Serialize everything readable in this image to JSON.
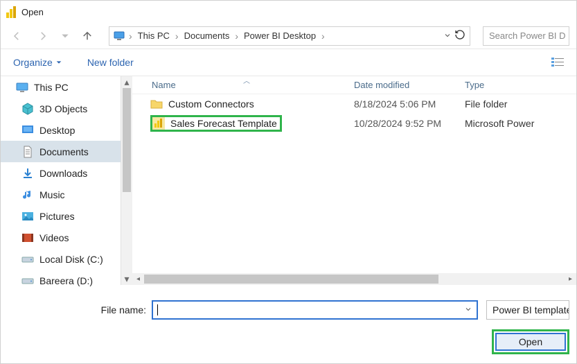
{
  "window": {
    "title": "Open"
  },
  "breadcrumb": {
    "root": "This PC",
    "a": "Documents",
    "b": "Power BI Desktop"
  },
  "search": {
    "placeholder": "Search Power BI D"
  },
  "toolbar": {
    "organize": "Organize",
    "newfolder": "New folder"
  },
  "columns": {
    "name": "Name",
    "date": "Date modified",
    "type": "Type"
  },
  "tree": {
    "root": "This PC",
    "items": [
      "3D Objects",
      "Desktop",
      "Documents",
      "Downloads",
      "Music",
      "Pictures",
      "Videos",
      "Local Disk (C:)",
      "Bareera (D:)"
    ]
  },
  "files": [
    {
      "name": "Custom Connectors",
      "date": "8/18/2024 5:06 PM",
      "type": "File folder"
    },
    {
      "name": "Sales Forecast Template",
      "date": "10/28/2024 9:52 PM",
      "type": "Microsoft Power"
    }
  ],
  "footer": {
    "fn_label": "File name:",
    "filetype": "Power BI template",
    "open": "Open"
  }
}
